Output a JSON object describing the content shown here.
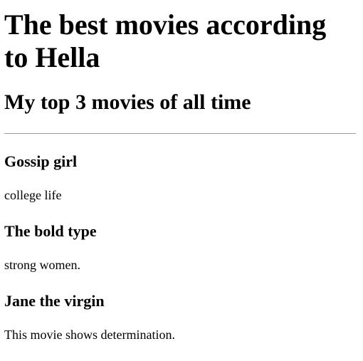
{
  "page": {
    "title": "The best movies according to Hella",
    "subtitle": "My top 3 movies of all time"
  },
  "movies": [
    {
      "title": "Gossip girl",
      "description": "college life"
    },
    {
      "title": "The bold type",
      "description": "strong women."
    },
    {
      "title": "Jane the virgin",
      "description": "This movie shows determination."
    }
  ]
}
